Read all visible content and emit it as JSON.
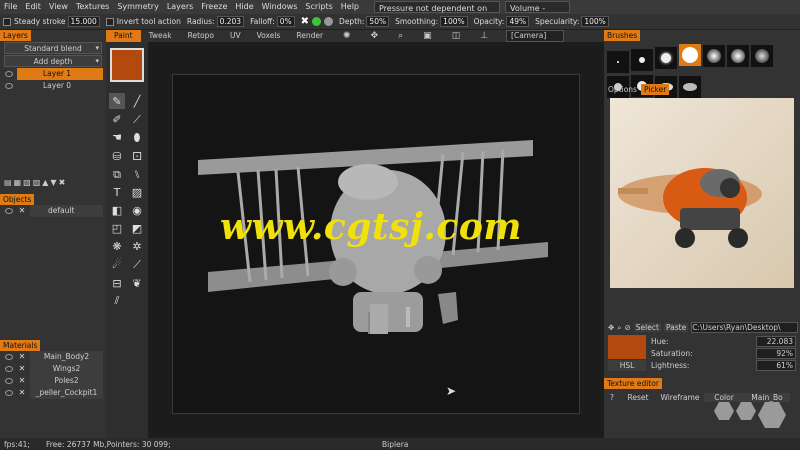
{
  "menu": [
    "File",
    "Edit",
    "View",
    "Textures",
    "Symmetry",
    "Layers",
    "Freeze",
    "Hide",
    "Windows",
    "Scripts",
    "Help"
  ],
  "toolbar": {
    "steady_label": "Steady stroke",
    "steady_value": "15.000",
    "invert_label": "Invert tool action",
    "radius_label": "Radius:",
    "radius_value": "0.203",
    "falloff_label": "Falloff:",
    "falloff_value": "0%",
    "depth_label": "Depth:",
    "depth_value": "50%",
    "smoothing_label": "Smoothing:",
    "smoothing_value": "100%",
    "opacity_label": "Opacity:",
    "opacity_value": "49%",
    "specularity_label": "Specularity:",
    "specularity_value": "100%",
    "pressure_drop": "Pressure not dependent on color",
    "volume_drop": "Volume - based"
  },
  "room_tabs": {
    "paint": "Paint",
    "tweak": "Tweak",
    "retopo": "Retopo",
    "uv": "UV",
    "voxels": "Voxels",
    "render": "Render",
    "camera": "[Camera]"
  },
  "layers": {
    "title": "Layers",
    "blend": "Standard blend",
    "depth": "Add depth",
    "items": [
      "Layer 1",
      "Layer 0"
    ]
  },
  "objects": {
    "title": "Objects",
    "items": [
      "default"
    ]
  },
  "materials": {
    "title": "Materials",
    "items": [
      "Main_Body2",
      "Wings2",
      "Poles2",
      "_peller_Cockpit1"
    ]
  },
  "brushes": {
    "title": "Brushes"
  },
  "picker": {
    "tab_options": "Options",
    "tab_picker": "Picker",
    "select": "Select",
    "paste": "Paste",
    "path": "C:\\Users\\Ryan\\Desktop\\",
    "hue_label": "Hue:",
    "hue_value": "22.083",
    "saturation_label": "Saturation:",
    "saturation_value": "92%",
    "lightness_label": "Lightness:",
    "lightness_value": "61%",
    "hsl_button": "HSL",
    "color": "#b24a0e"
  },
  "texture_editor": {
    "title": "Texture editor",
    "help": "?",
    "reset": "Reset",
    "wireframe": "Wireframe",
    "color": "Color",
    "material": "Main_Bo"
  },
  "watermark": "www.cgtsj.com",
  "status": {
    "fps": "fps:41;",
    "free": "Free: 26737 Mb,Pointers: 30 099;",
    "model": "Biplera"
  },
  "colors": {
    "accent": "#e07a14",
    "watermark": "#f0e10a"
  }
}
